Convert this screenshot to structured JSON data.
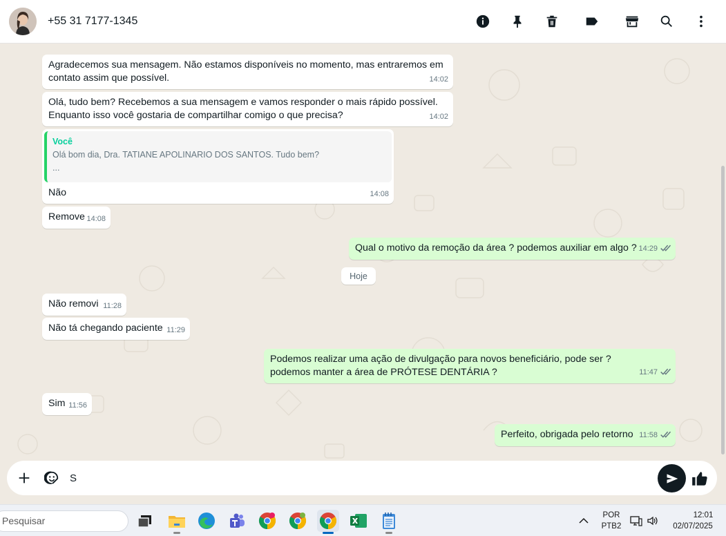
{
  "header": {
    "contact_name": "+55 31 7177-1345",
    "icons": [
      "info-icon",
      "pin-icon",
      "delete-icon",
      "label-icon",
      "store-icon",
      "search-icon",
      "more-options-icon"
    ]
  },
  "messages": [
    {
      "id": "m1",
      "dir": "in",
      "text": "Agradecemos sua mensagem. Não estamos disponíveis no momento, mas entraremos em contato assim que possível.",
      "time": "14:02"
    },
    {
      "id": "m2",
      "dir": "in",
      "text": "Olá, tudo bem? Recebemos a sua mensagem e vamos responder o mais rápido possível. Enquanto isso você gostaria de compartilhar comigo o que precisa?",
      "time": "14:02"
    },
    {
      "id": "m3",
      "dir": "in",
      "quote_author": "Você",
      "quote_text": "Olá bom dia, Dra.   TATIANE APOLINARIO DOS SANTOS. Tudo bem?",
      "quote_more": "...",
      "text": "Não",
      "time": "14:08"
    },
    {
      "id": "m4",
      "dir": "in",
      "text": "Remove",
      "time": "14:08"
    },
    {
      "id": "m5",
      "dir": "out",
      "text": "Qual o motivo da remoção da área ? podemos auxiliar em algo ?",
      "time": "14:29"
    },
    {
      "id": "m6",
      "dir": "in",
      "text": "Não removi",
      "time": "11:28"
    },
    {
      "id": "m7",
      "dir": "in",
      "text": "Não tá chegando paciente",
      "time": "11:29"
    },
    {
      "id": "m8",
      "dir": "out",
      "text": "Podemos realizar uma ação de divulgação para novos beneficiário, pode ser ? podemos manter a área de  PRÓTESE DENTÁRIA ?",
      "time": "11:47"
    },
    {
      "id": "m9",
      "dir": "in",
      "text": "Sim",
      "time": "11:56"
    },
    {
      "id": "m10",
      "dir": "out",
      "text": "Perfeito, obrigada pelo retorno",
      "time": "11:58"
    }
  ],
  "day_separator": "Hoje",
  "composer": {
    "value": "S",
    "icons": [
      "plus-icon",
      "sticker-icon",
      "send-icon",
      "thumbs-up-icon"
    ]
  },
  "taskbar": {
    "search_placeholder": "Pesquisar",
    "apps": [
      "task-view",
      "file-explorer",
      "edge",
      "teams",
      "chrome",
      "chrome",
      "chrome",
      "excel",
      "notepad"
    ],
    "language_top": "POR",
    "language_bottom": "PTB2",
    "time": "12:01",
    "date": "02/07/2025"
  },
  "colors": {
    "chat_bg": "#efeae2",
    "incoming_bubble": "#ffffff",
    "outgoing_bubble": "#d9fdd3",
    "quote_accent": "#25d366",
    "quote_author": "#06cf9c"
  }
}
